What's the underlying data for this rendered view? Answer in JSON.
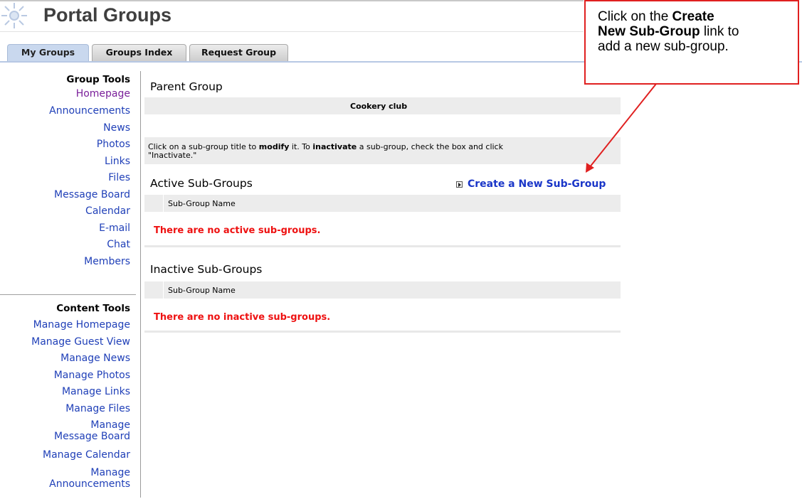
{
  "header": {
    "title": "Portal Groups"
  },
  "tabs": [
    {
      "label": "My Groups",
      "active": true
    },
    {
      "label": "Groups Index",
      "active": false
    },
    {
      "label": "Request Group",
      "active": false
    }
  ],
  "sidebar": {
    "group_tools_title": "Group Tools",
    "group_tools": [
      "Homepage",
      "Announcements",
      "News",
      "Photos",
      "Links",
      "Files",
      "Message Board",
      "Calendar",
      "E-mail",
      "Chat",
      "Members"
    ],
    "content_tools_title": "Content Tools",
    "content_tools": [
      "Manage Homepage",
      "Manage Guest View",
      "Manage News",
      "Manage Photos",
      "Manage Links",
      "Manage Files",
      "Manage",
      "Message Board",
      "Manage Calendar",
      "Manage",
      "Announcements"
    ]
  },
  "main": {
    "parent_group_title": "Parent Group",
    "parent_group_name": "Cookery club",
    "instructions": {
      "p1": "Click on a sub-group title to ",
      "b1": "modify",
      "p2": " it. To ",
      "b2": "inactivate",
      "p3": " a sub-group, check the box and click",
      "line2": "\"Inactivate.\""
    },
    "active_title": "Active Sub-Groups",
    "create_link": "Create a New Sub-Group",
    "active_column": "Sub-Group Name",
    "active_empty": "There are no active sub-groups.",
    "inactive_title": "Inactive Sub-Groups",
    "inactive_column": "Sub-Group Name",
    "inactive_empty": "There are no inactive sub-groups."
  },
  "callout": {
    "t1": "Click on the ",
    "b1": "Create",
    "b2": "New Sub-Group",
    "t2": " link to",
    "t3": "add a new sub-group."
  },
  "colors": {
    "accent_red": "#e02020",
    "link_blue": "#2040b8",
    "tab_active": "#c9d8ee"
  }
}
